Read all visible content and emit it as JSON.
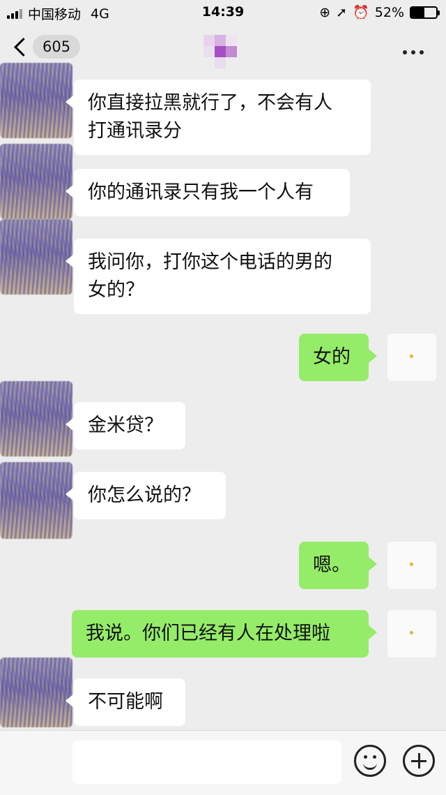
{
  "status_bar": {
    "carrier": "中国移动",
    "network": "4G",
    "time": "14:39",
    "battery": "52%",
    "battery_level": 0.52
  },
  "header": {
    "back_count": "605",
    "more_icon": "more-dots-icon"
  },
  "messages": [
    {
      "side": "in",
      "lines": [
        "你直接拉黑就行了，不会有人",
        "打通讯录分"
      ]
    },
    {
      "side": "in",
      "lines": [
        "你的通讯录只有我一个人有"
      ]
    },
    {
      "side": "in",
      "lines": [
        "我问你，打你这个电话的男的",
        "女的？"
      ]
    },
    {
      "side": "out",
      "lines": [
        "女的"
      ]
    },
    {
      "side": "in",
      "lines": [
        "金米贷？"
      ]
    },
    {
      "side": "in",
      "lines": [
        "你怎么说的？"
      ]
    },
    {
      "side": "out",
      "lines": [
        "嗯。"
      ]
    },
    {
      "side": "out",
      "lines": [
        "我说。你们已经有人在处理啦"
      ]
    },
    {
      "side": "in",
      "lines": [
        "不可能啊"
      ]
    }
  ],
  "input_bar": {
    "text": "",
    "emoji_icon": "emoji-icon",
    "plus_icon": "plus-icon"
  },
  "colors": {
    "background": "#ededed",
    "incoming_bubble": "#ffffff",
    "outgoing_bubble": "#95ec69"
  }
}
